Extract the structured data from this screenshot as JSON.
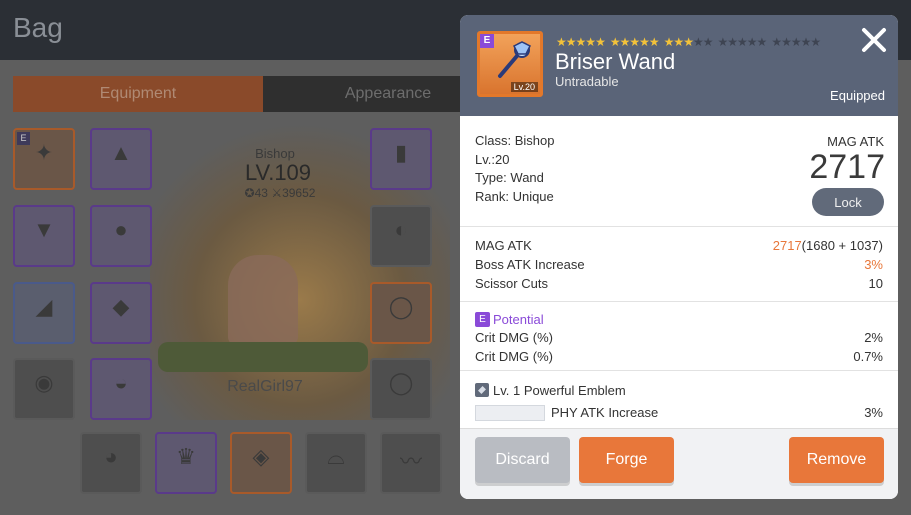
{
  "background": {
    "title": "Bag",
    "tabs": [
      "Equipment",
      "Appearance"
    ],
    "character": {
      "job": "Bishop",
      "level": "LV.109",
      "stat_a": "43",
      "stat_b": "39652",
      "name_tag": "RealGirl97"
    }
  },
  "item": {
    "rank_badge": "E",
    "level_badge": "Lv.20",
    "stars_filled": 13,
    "stars_total": 25,
    "name": "Briser Wand",
    "tradability": "Untradable",
    "status": "Equipped"
  },
  "base_info": {
    "class_line": "Class: Bishop",
    "level_line": "Lv.:20",
    "type_line": "Type: Wand",
    "rank_line": "Rank: Unique",
    "stat_type": "MAG ATK",
    "stat_value": "2717",
    "lock_label": "Lock"
  },
  "stats": [
    {
      "label": "MAG ATK",
      "value_highlight": "2717",
      "value_rest": "(1680 + 1037)"
    },
    {
      "label": "Boss ATK Increase",
      "value_highlight": "3%",
      "value_rest": ""
    },
    {
      "label": "Scissor Cuts",
      "value_highlight": "",
      "value_rest": "10"
    }
  ],
  "potential": {
    "badge": "E",
    "title": "Potential",
    "lines": [
      {
        "label": "Crit DMG (%)",
        "value": "2%"
      },
      {
        "label": "Crit DMG (%)",
        "value": "0.7%"
      }
    ]
  },
  "emblem": {
    "title": "Lv. 1 Powerful Emblem",
    "lines": [
      {
        "label": "PHY ATK Increase",
        "value": "3%"
      }
    ]
  },
  "buttons": {
    "discard": "Discard",
    "forge": "Forge",
    "remove": "Remove"
  },
  "colors": {
    "accent": "#e8773a",
    "header": "#5a6478",
    "potential": "#8a4ad8"
  }
}
